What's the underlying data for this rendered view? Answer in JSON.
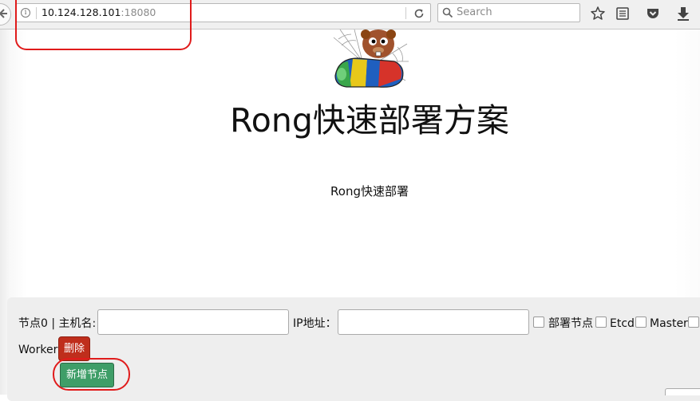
{
  "browser": {
    "url_host": "10.124.128.101",
    "url_port": ":18080",
    "search_placeholder": "Search"
  },
  "page": {
    "title": "Rong快速部署方案",
    "subtitle": "Rong快速部署"
  },
  "node_form": {
    "node_label": "节点0 | 主机名:",
    "hostname_value": "",
    "ip_label": "IP地址：",
    "ip_value": "",
    "checkbox_deploy": "部署节点",
    "checkbox_etcd": "Etcd",
    "checkbox_master": "Master",
    "checkbox_worker": "Worker",
    "delete_button": "删除",
    "add_node_button": "新增节点"
  },
  "colors": {
    "delete_button": "#bf2e1c",
    "add_button": "#3f9e68",
    "annotation": "#e01b1b"
  },
  "icons": [
    "back-arrow-icon",
    "info-icon",
    "reload-icon",
    "search-icon",
    "bookmark-star-icon",
    "reading-list-icon",
    "pocket-icon",
    "download-icon",
    "mascot-logo"
  ]
}
